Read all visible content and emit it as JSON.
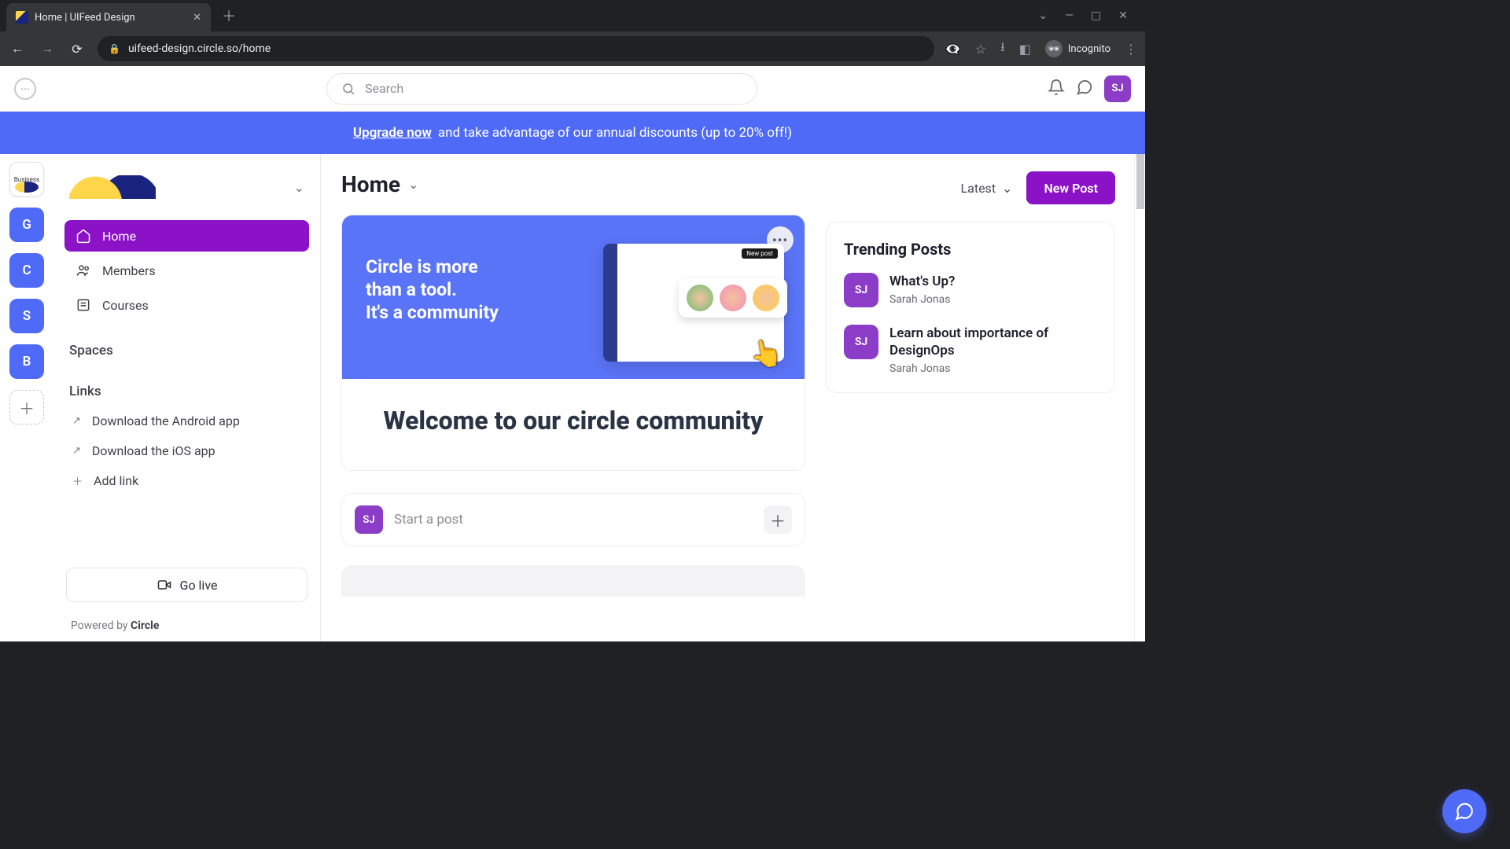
{
  "browser": {
    "tab_title": "Home | UIFeed Design",
    "url": "uifeed-design.circle.so/home",
    "incognito_label": "Incognito"
  },
  "topbar": {
    "search_placeholder": "Search",
    "avatar_initials": "SJ"
  },
  "banner": {
    "cta": "Upgrade now",
    "rest": "and take advantage of our annual discounts (up to 20% off!)"
  },
  "rail": {
    "workspace_label": "Business",
    "tiles": [
      "G",
      "C",
      "S",
      "B"
    ]
  },
  "sidebar": {
    "nav": [
      {
        "label": "Home",
        "active": true
      },
      {
        "label": "Members",
        "active": false
      },
      {
        "label": "Courses",
        "active": false
      }
    ],
    "spaces_label": "Spaces",
    "links_label": "Links",
    "links": [
      {
        "label": "Download the Android app"
      },
      {
        "label": "Download the iOS app"
      }
    ],
    "add_link_label": "Add link",
    "go_live_label": "Go live",
    "powered_prefix": "Powered by ",
    "powered_brand": "Circle"
  },
  "main": {
    "title": "Home",
    "sort_label": "Latest",
    "new_post_label": "New Post",
    "hero_tagline_l1": "Circle is more",
    "hero_tagline_l2": "than a tool.",
    "hero_tagline_l3": "It's a community",
    "hero_badge": "New post",
    "welcome_title": "Welcome to our circle community",
    "start_post_placeholder": "Start a post",
    "start_post_avatar": "SJ"
  },
  "trending": {
    "title": "Trending Posts",
    "items": [
      {
        "avatar": "SJ",
        "title": "What's Up?",
        "author": "Sarah Jonas"
      },
      {
        "avatar": "SJ",
        "title": "Learn about importance of DesignOps",
        "author": "Sarah Jonas"
      }
    ]
  }
}
